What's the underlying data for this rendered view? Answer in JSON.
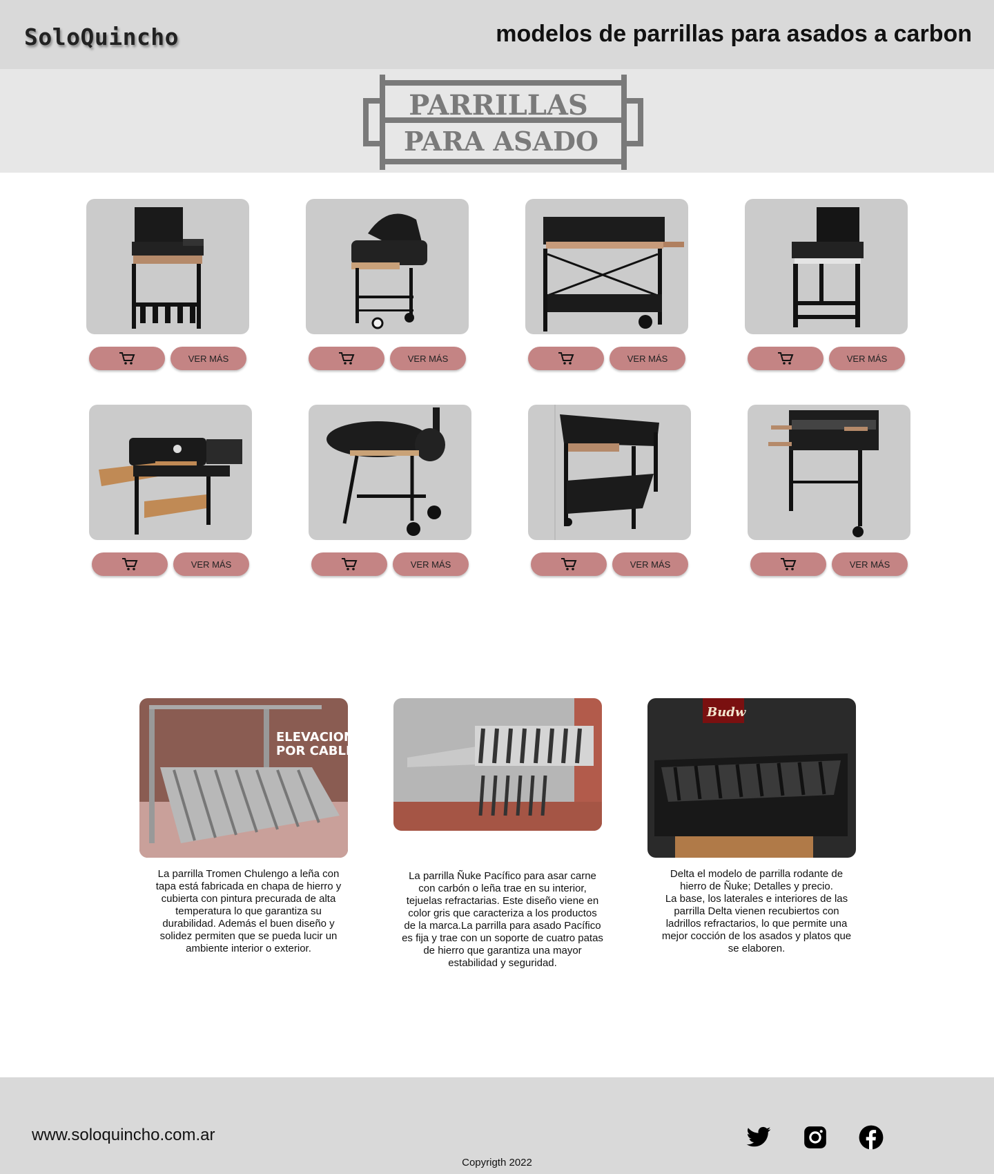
{
  "header": {
    "brand": "SoloQuincho",
    "title": "modelos de parrillas para asados a carbon"
  },
  "banner": {
    "logo_line1": "PARRILLAS",
    "logo_line2": "PARA ASADO"
  },
  "products": [
    {
      "cart_icon": "cart-icon",
      "more_label": "VER MÁS"
    },
    {
      "cart_icon": "cart-icon",
      "more_label": "VER MÁS"
    },
    {
      "cart_icon": "cart-icon",
      "more_label": "VER MÁS"
    },
    {
      "cart_icon": "cart-icon",
      "more_label": "VER MÁS"
    },
    {
      "cart_icon": "cart-icon",
      "more_label": "VER MÁS"
    },
    {
      "cart_icon": "cart-icon",
      "more_label": "VER MÁS"
    },
    {
      "cart_icon": "cart-icon",
      "more_label": "VER MÁS"
    },
    {
      "cart_icon": "cart-icon",
      "more_label": "VER MÁS"
    }
  ],
  "featured": [
    {
      "photo_overlay": "ELEVACION\nPOR CABLE",
      "text": "La parrilla Tromen Chulengo a leña con\ntapa está fabricada en chapa de hierro y\ncubierta con pintura precurada de alta\ntemperatura lo que garantiza su\ndurabilidad. Además el buen diseño y\nsolidez permiten que se pueda lucir un\nambiente interior o exterior."
    },
    {
      "photo_overlay": "",
      "text": "La parrilla Ñuke Pacífico para asar carne\ncon carbón o leña trae en su interior,\ntejuelas refractarias. Este diseño viene en\ncolor gris que caracteriza a los productos\nde la marca.La parrilla para asado Pacífico\nes fija y trae con un soporte de cuatro patas\nde hierro que garantiza una mayor\nestabilidad y seguridad."
    },
    {
      "photo_overlay": "Budw",
      "text": "Delta el modelo de parrilla rodante de\nhierro de Ñuke; Detalles y precio.\nLa base, los laterales e interiores de las\nparrilla Delta vienen recubiertos con\nladrillos refractarios, lo que permite una\nmejor cocción de los asados y platos que\nse elaboren."
    }
  ],
  "footer": {
    "url": "www.soloquincho.com.ar",
    "copyright": "Copyrigth 2022",
    "social_icons": [
      "twitter-icon",
      "instagram-icon",
      "facebook-icon"
    ]
  },
  "colors": {
    "header_bg": "#d9d9d9",
    "banner_bg": "#e7e7e7",
    "button_bg": "#c48484",
    "card_bg": "#cbcbcb"
  }
}
